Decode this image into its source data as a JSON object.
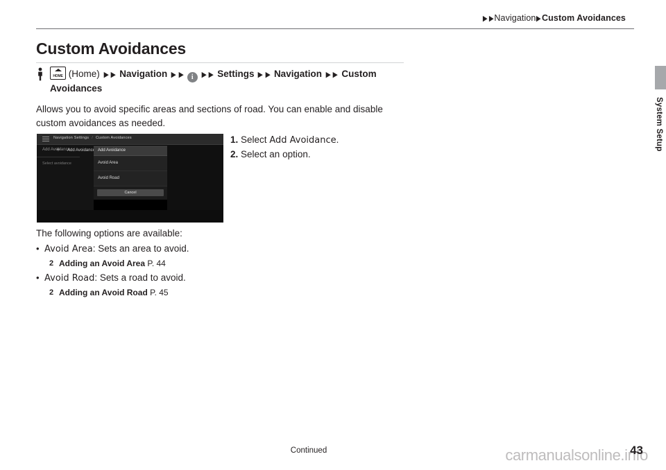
{
  "breadcrumb": {
    "arrow": "▶",
    "items": [
      "Navigation",
      "Custom Avoidances"
    ]
  },
  "side_tab_label": "System Setup",
  "page_title": "Custom Avoidances",
  "path": {
    "home_label": "HOME",
    "home_paren": "(Home)",
    "sep": "▶",
    "item1": "Navigation",
    "info_icon": "i",
    "item2": "Settings",
    "item3": "Navigation",
    "item4": "Custom",
    "item5": "Avoidances"
  },
  "intro": "Allows you to avoid specific areas and sections of road. You can enable and disable custom avoidances as needed.",
  "screenshot": {
    "breadcrumb_1": "Navigation Settings",
    "breadcrumb_sep": "/",
    "breadcrumb_2": "Custom Avoidances",
    "left_row1": "Add Avoidance",
    "left_row2": "Select avoidance",
    "plus": "+",
    "dialog_title": "Add Avoidance",
    "dialog_item_1": "Avoid Area",
    "dialog_item_2": "Avoid Road",
    "dialog_cancel": "Cancel"
  },
  "steps": [
    {
      "num": "1.",
      "text_before": "Select ",
      "command": "Add Avoidance",
      "text_after": "."
    },
    {
      "num": "2.",
      "text_before": "Select an option.",
      "command": "",
      "text_after": ""
    }
  ],
  "options": {
    "lead": "The following options are available:",
    "bullet": "•",
    "refmark": "2",
    "items": [
      {
        "name": "Avoid Area",
        "desc": ": Sets an area to avoid.",
        "ref_title": "Adding an Avoid Area",
        "ref_page": "P. 44"
      },
      {
        "name": "Avoid Road",
        "desc": ": Sets a road to avoid.",
        "ref_title": "Adding an Avoid Road",
        "ref_page": "P. 45"
      }
    ]
  },
  "footer": {
    "continued": "Continued",
    "page_number": "43",
    "watermark": "carmanualsonline.info"
  }
}
